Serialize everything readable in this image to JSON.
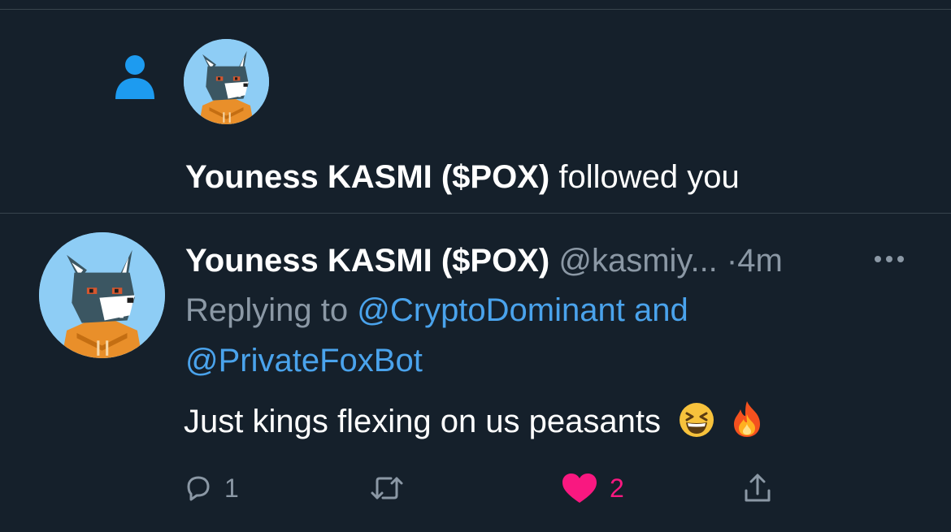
{
  "follow_notification": {
    "name": "Youness KASMI ($POX)",
    "action_text": "followed you"
  },
  "tweet": {
    "display_name": "Youness KASMI ($POX)",
    "handle": "@kasmiy...",
    "separator": "·",
    "time": "4m",
    "replying_prefix": "Replying to",
    "replying_users": [
      "@CryptoDominant",
      "@PrivateFoxBot"
    ],
    "replying_joiner": "and",
    "text": "Just kings flexing on us peasants",
    "emojis": [
      "grinning-squinting-face",
      "fire"
    ],
    "reply_count": "1",
    "retweet_count": "",
    "like_count": "2"
  },
  "colors": {
    "background": "#15202b",
    "divider": "#38444d",
    "muted_text": "#8b98a5",
    "link": "#4aa3ec",
    "like": "#f91880",
    "follow_icon": "#1d9bf0"
  },
  "icons": {
    "follow": "person-icon",
    "more": "more-horizontal-icon",
    "reply": "reply-icon",
    "retweet": "retweet-icon",
    "like": "heart-icon",
    "share": "share-icon"
  }
}
